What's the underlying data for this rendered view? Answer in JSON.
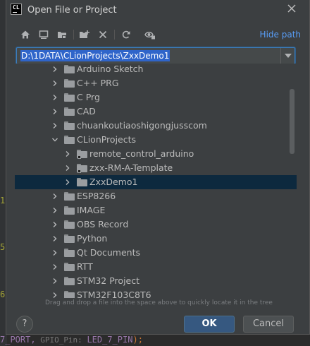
{
  "window": {
    "title": "Open File or Project",
    "app_icon_text": "CL"
  },
  "toolbar": {
    "icons": [
      "home-icon",
      "desktop-icon",
      "project-folder-icon",
      "new-folder-icon",
      "delete-icon",
      "refresh-icon",
      "show-hidden-icon"
    ],
    "hide_path_label": "Hide path"
  },
  "path": {
    "value": "D:\\1DATA\\CLionProjects\\ZxxDemo1"
  },
  "tree": {
    "items": [
      {
        "label": "Arduino Sketch",
        "depth": 1,
        "expanded": false,
        "selected": false,
        "module": false
      },
      {
        "label": "C++ PRG",
        "depth": 1,
        "expanded": false,
        "selected": false,
        "module": false
      },
      {
        "label": "C Prg",
        "depth": 1,
        "expanded": false,
        "selected": false,
        "module": false
      },
      {
        "label": "CAD",
        "depth": 1,
        "expanded": false,
        "selected": false,
        "module": false
      },
      {
        "label": "chuankoutiaoshigongjusscom",
        "depth": 1,
        "expanded": false,
        "selected": false,
        "module": false
      },
      {
        "label": "CLionProjects",
        "depth": 1,
        "expanded": true,
        "selected": false,
        "module": false
      },
      {
        "label": "remote_control_arduino",
        "depth": 2,
        "expanded": false,
        "selected": false,
        "module": true
      },
      {
        "label": "zxx-RM-A-Template",
        "depth": 2,
        "expanded": false,
        "selected": false,
        "module": true
      },
      {
        "label": "ZxxDemo1",
        "depth": 2,
        "expanded": false,
        "selected": true,
        "module": false
      },
      {
        "label": "ESP8266",
        "depth": 1,
        "expanded": false,
        "selected": false,
        "module": false
      },
      {
        "label": "IMAGE",
        "depth": 1,
        "expanded": false,
        "selected": false,
        "module": false
      },
      {
        "label": "OBS Record",
        "depth": 1,
        "expanded": false,
        "selected": false,
        "module": false
      },
      {
        "label": "Python",
        "depth": 1,
        "expanded": false,
        "selected": false,
        "module": false
      },
      {
        "label": "Qt Documents",
        "depth": 1,
        "expanded": false,
        "selected": false,
        "module": false
      },
      {
        "label": "RTT",
        "depth": 1,
        "expanded": false,
        "selected": false,
        "module": false
      },
      {
        "label": "STM32 Project",
        "depth": 1,
        "expanded": false,
        "selected": false,
        "module": false
      },
      {
        "label": "STM32F103C8T6",
        "depth": 1,
        "expanded": false,
        "selected": false,
        "module": false
      }
    ]
  },
  "hint": "Drag and drop a file into the space above to quickly locate it in the tree",
  "buttons": {
    "help": "?",
    "ok": "OK",
    "cancel": "Cancel"
  },
  "editor": {
    "line_numbers": [
      "1",
      "5",
      "6"
    ],
    "bottom_code_a": "7_PORT,",
    "bottom_code_hint": " GPIO_Pin: ",
    "bottom_code_b": "LED_7_PIN",
    "bottom_code_c": ");"
  },
  "colors": {
    "dialog_bg": "#3c3f41",
    "accent_link": "#589df6",
    "selection": "#2f65ca",
    "ok_button": "#365880"
  }
}
